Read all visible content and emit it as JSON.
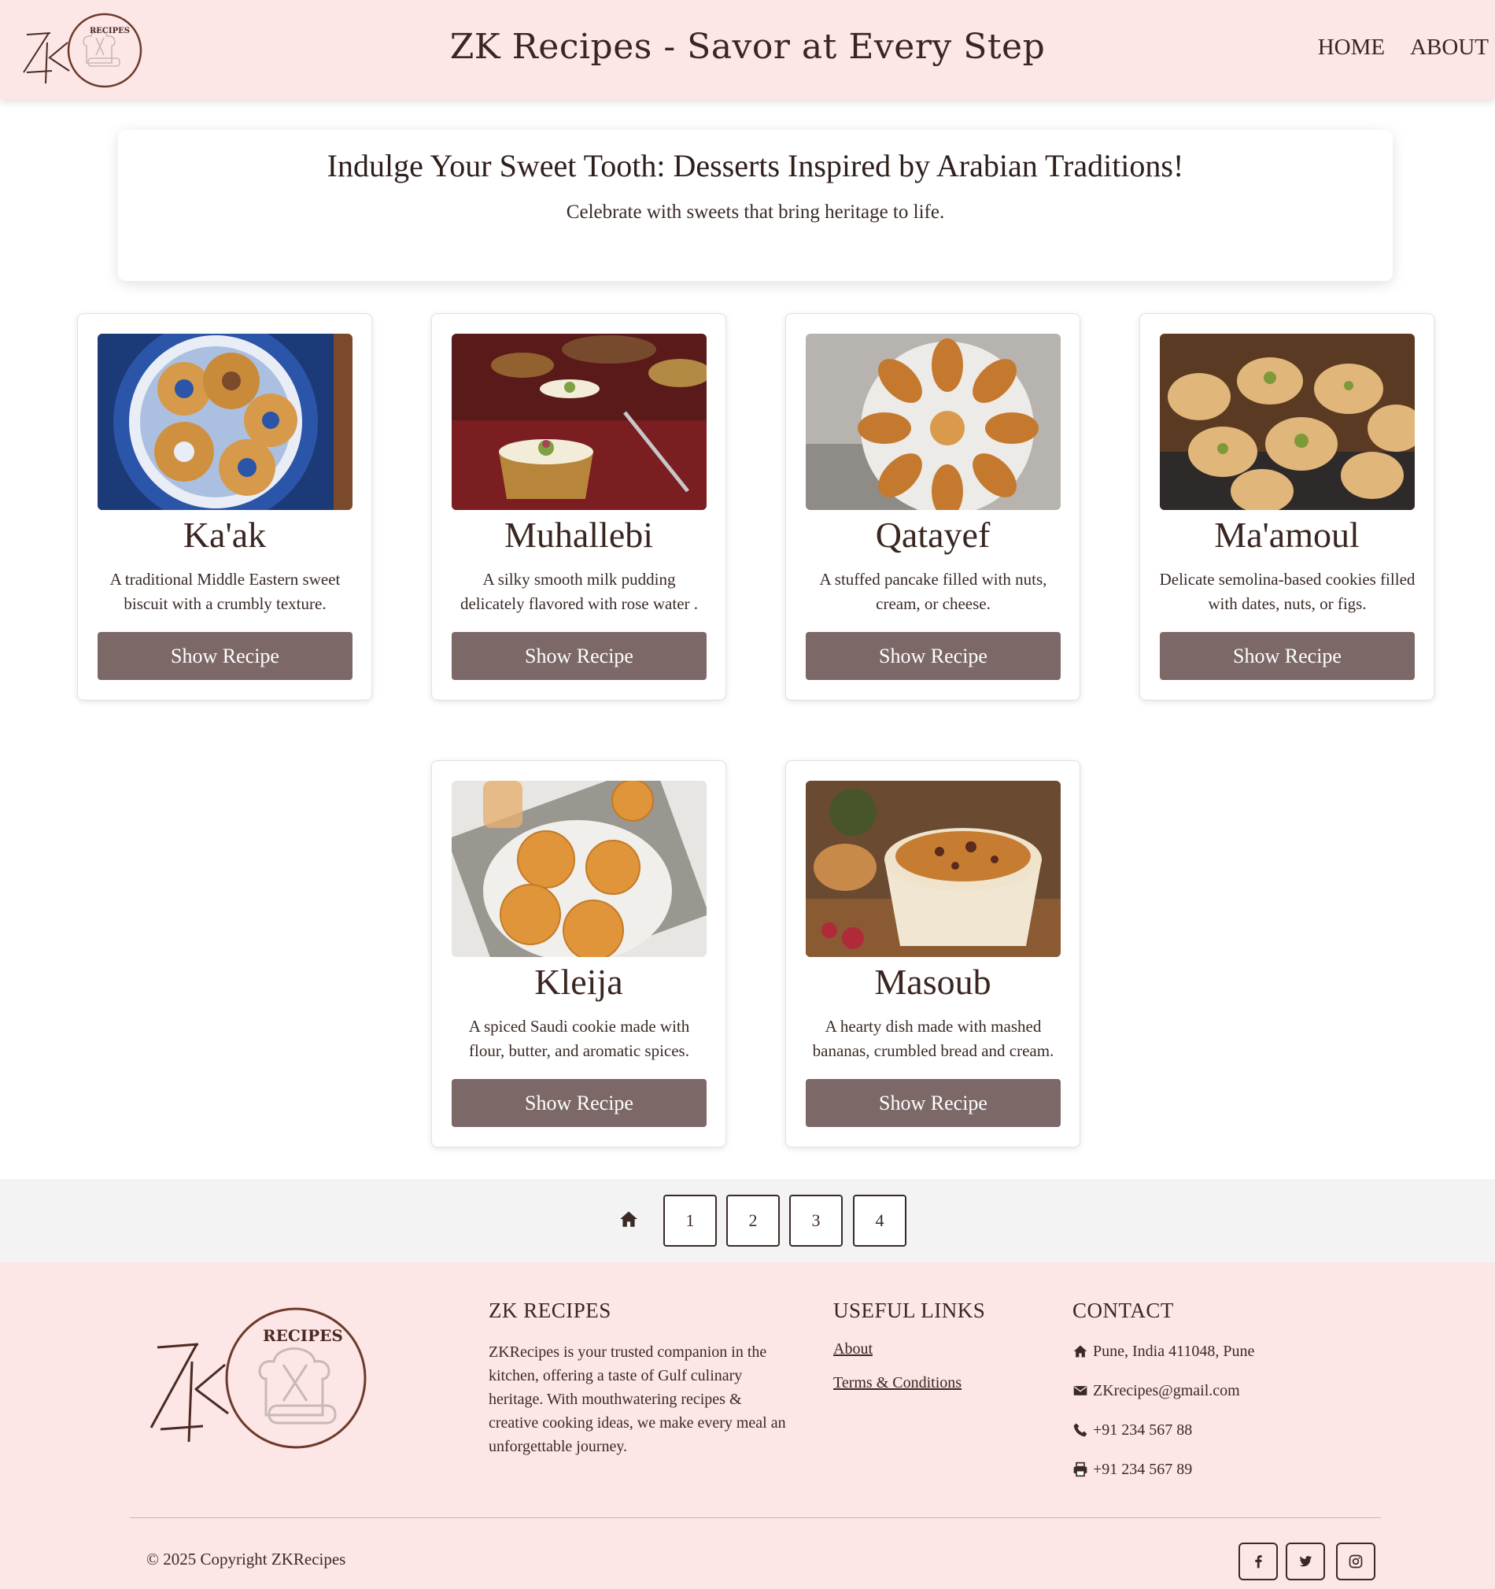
{
  "header": {
    "title": "ZK Recipes - Savor at Every Step",
    "nav": [
      "HOME",
      "ABOUT"
    ]
  },
  "hero": {
    "heading": "Indulge Your Sweet Tooth: Desserts Inspired by Arabian Traditions!",
    "subheading": "Celebrate with sweets that bring heritage to life."
  },
  "recipes": [
    {
      "name": "Ka'ak",
      "description": "A traditional Middle Eastern sweet biscuit with a crumbly texture.",
      "button": "Show Recipe"
    },
    {
      "name": "Muhallebi",
      "description": "A silky smooth milk pudding delicately flavored with rose water .",
      "button": "Show Recipe"
    },
    {
      "name": "Qatayef",
      "description": "A stuffed pancake filled with nuts, cream, or cheese.",
      "button": "Show Recipe"
    },
    {
      "name": "Ma'amoul",
      "description": "Delicate semolina-based cookies filled with dates, nuts, or figs.",
      "button": "Show Recipe"
    },
    {
      "name": "Kleija",
      "description": "A spiced Saudi cookie made with flour, butter, and aromatic spices.",
      "button": "Show Recipe"
    },
    {
      "name": "Masoub",
      "description": "A hearty dish made with mashed bananas, crumbled bread and cream.",
      "button": "Show Recipe"
    }
  ],
  "pagination": {
    "home_icon": "home-icon",
    "pages": [
      "1",
      "2",
      "3",
      "4"
    ]
  },
  "footer": {
    "logo_text": "RECIPES",
    "about_title": "ZK RECIPES",
    "about_text": "ZKRecipes is your trusted companion in the kitchen, offering a taste of Gulf culinary heritage. With mouthwatering recipes & creative cooking ideas, we make every meal an unforgettable journey.",
    "links_title": "USEFUL LINKS",
    "links": [
      "About",
      "Terms & Conditions"
    ],
    "contact_title": "CONTACT",
    "contact": {
      "address": "Pune, India 411048, Pune",
      "email": "ZKrecipes@gmail.com",
      "phone": "+91 234 567 88",
      "fax": "+91 234 567 89"
    },
    "copyright": "© 2025 Copyright ZKRecipes",
    "social_icons": [
      "facebook-icon",
      "twitter-icon",
      "instagram-icon"
    ]
  },
  "colors": {
    "header_bg": "#fde6e6",
    "button_bg": "#7d6868",
    "pagination_bg": "#f3f3f3",
    "text_dark": "#3a2620"
  }
}
